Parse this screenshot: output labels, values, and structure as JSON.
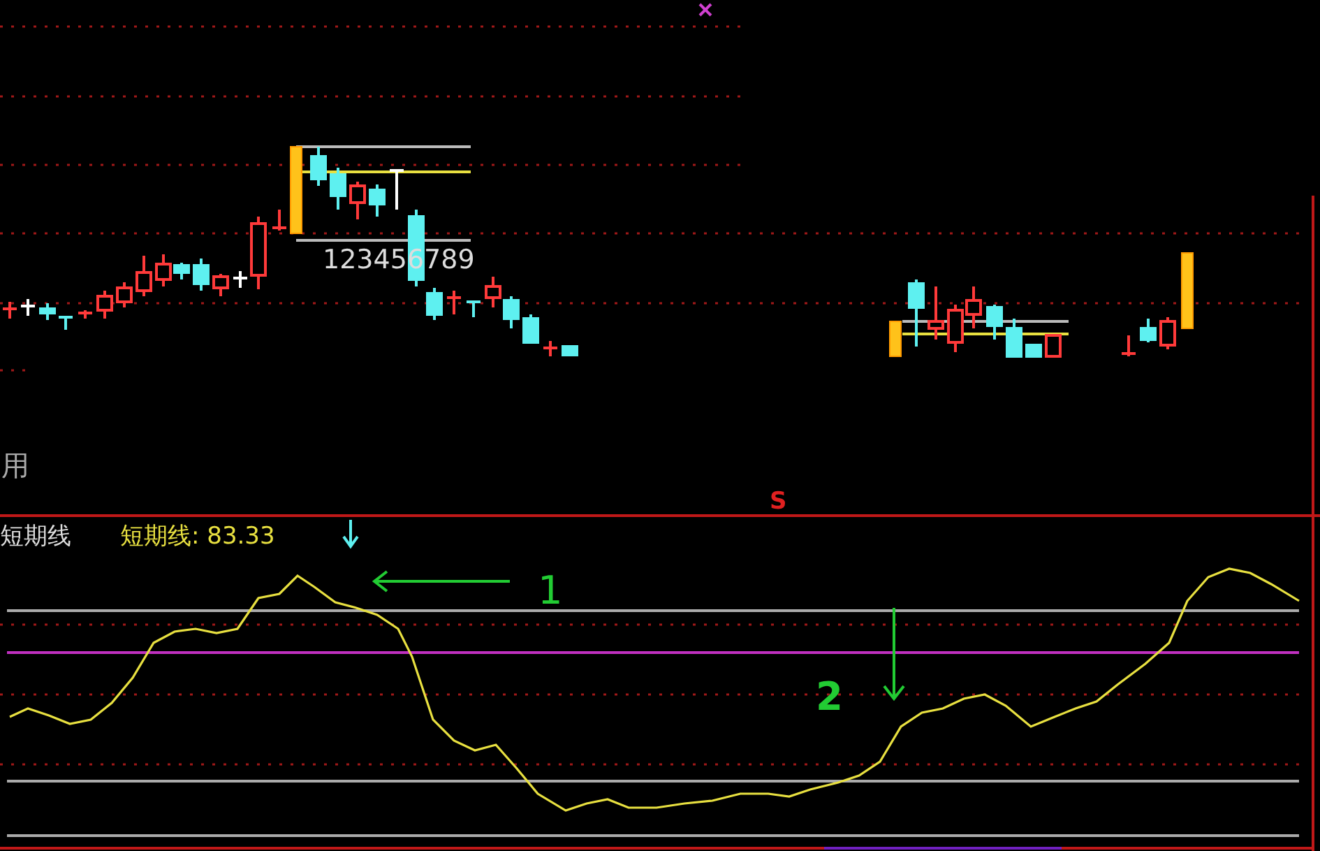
{
  "price_pane": {
    "cut_label": "用",
    "count_label": "123456789",
    "signal_label": "S"
  },
  "indicator_pane": {
    "name": "短期线",
    "legend": "短期线: 83.33",
    "annotations": [
      {
        "label": "1",
        "kind": "left-arrow"
      },
      {
        "label": "2",
        "kind": "down-arrow"
      }
    ]
  }
}
